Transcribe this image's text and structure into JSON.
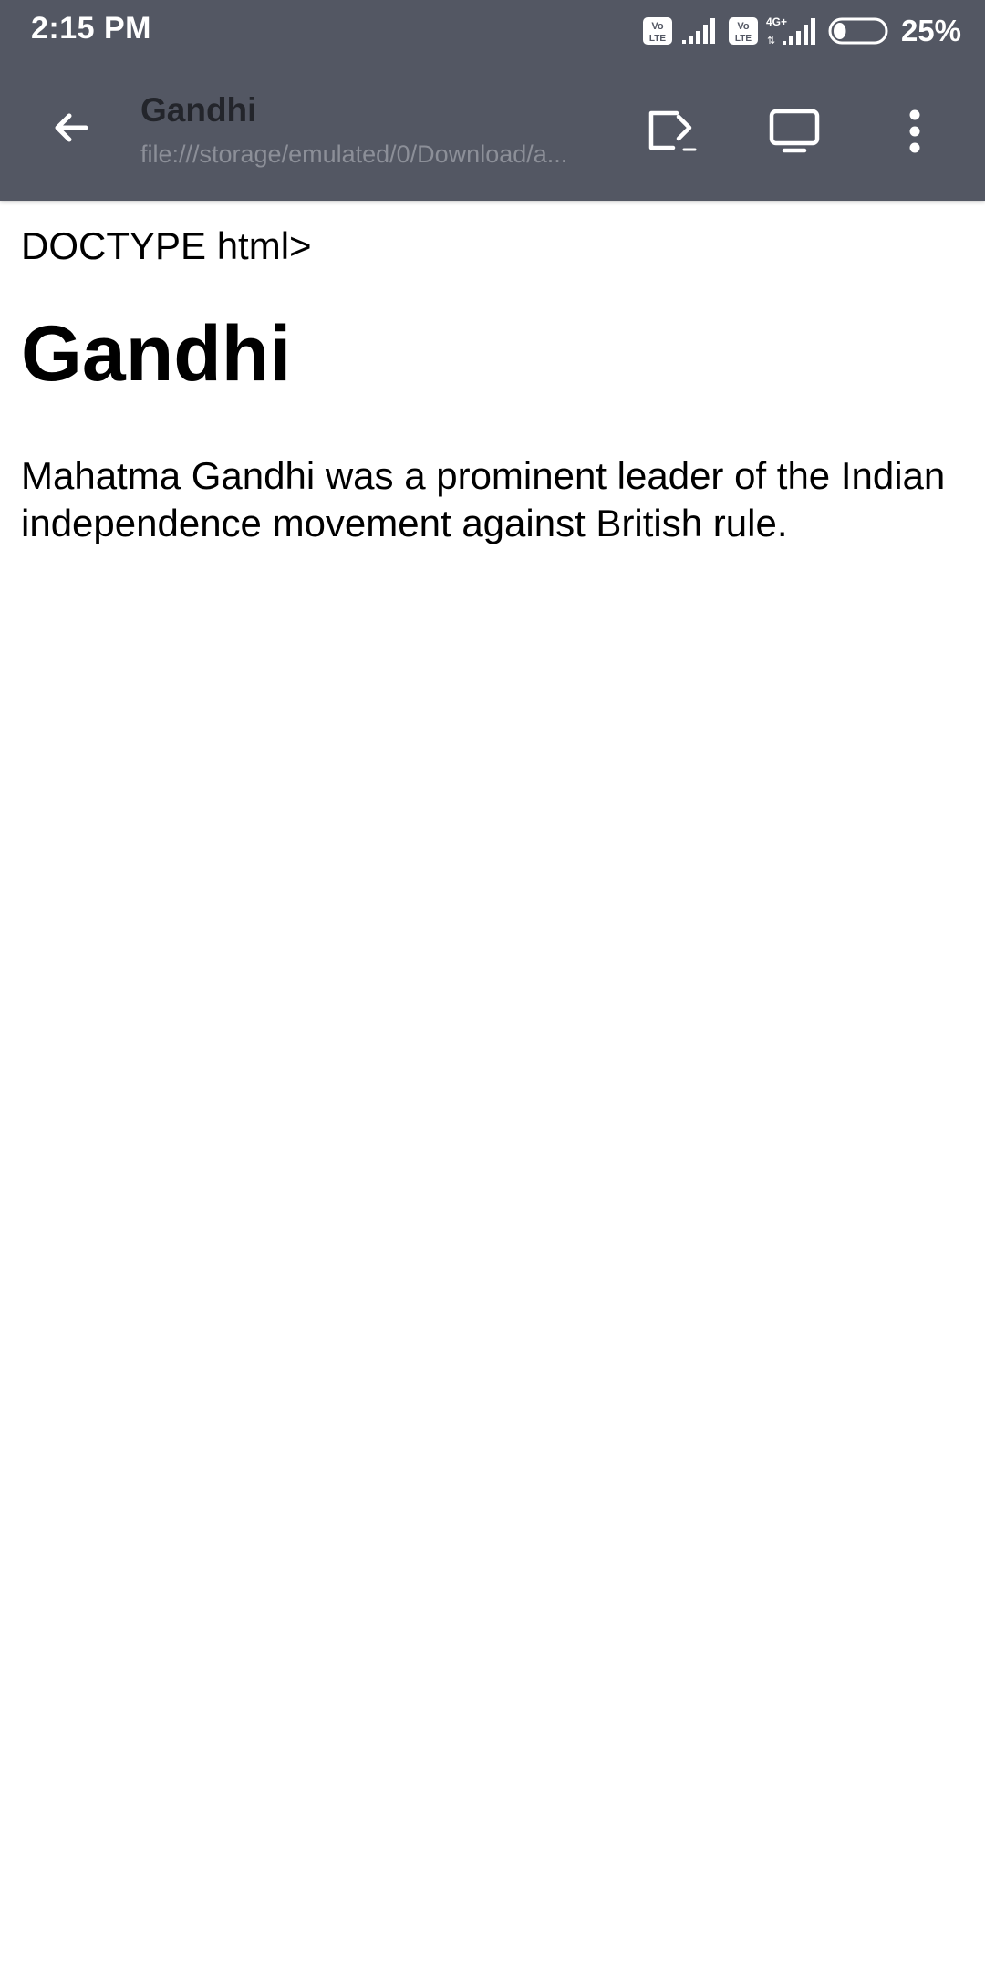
{
  "status_bar": {
    "time": "2:15 PM",
    "battery_percent": "25%",
    "sim1_badge": [
      "Vo",
      "LTE"
    ],
    "sim2_badge": [
      "Vo",
      "LTE"
    ],
    "network_type": "4G+",
    "battery_level": 0.25
  },
  "toolbar": {
    "title": "Gandhi",
    "url": "file:///storage/emulated/0/Download/a...",
    "icons": [
      "back-arrow-icon",
      "open-in-app-icon",
      "desktop-view-icon",
      "more-vert-icon"
    ]
  },
  "content": {
    "doctype_text": "DOCTYPE html>",
    "heading": "Gandhi",
    "paragraph": "Mahatma Gandhi was a prominent leader of the Indian independence movement against British rule."
  },
  "colors": {
    "toolbar_bg": "#535763",
    "title_text": "#23252b",
    "url_text": "#8c8f98",
    "page_bg": "#ffffff"
  }
}
